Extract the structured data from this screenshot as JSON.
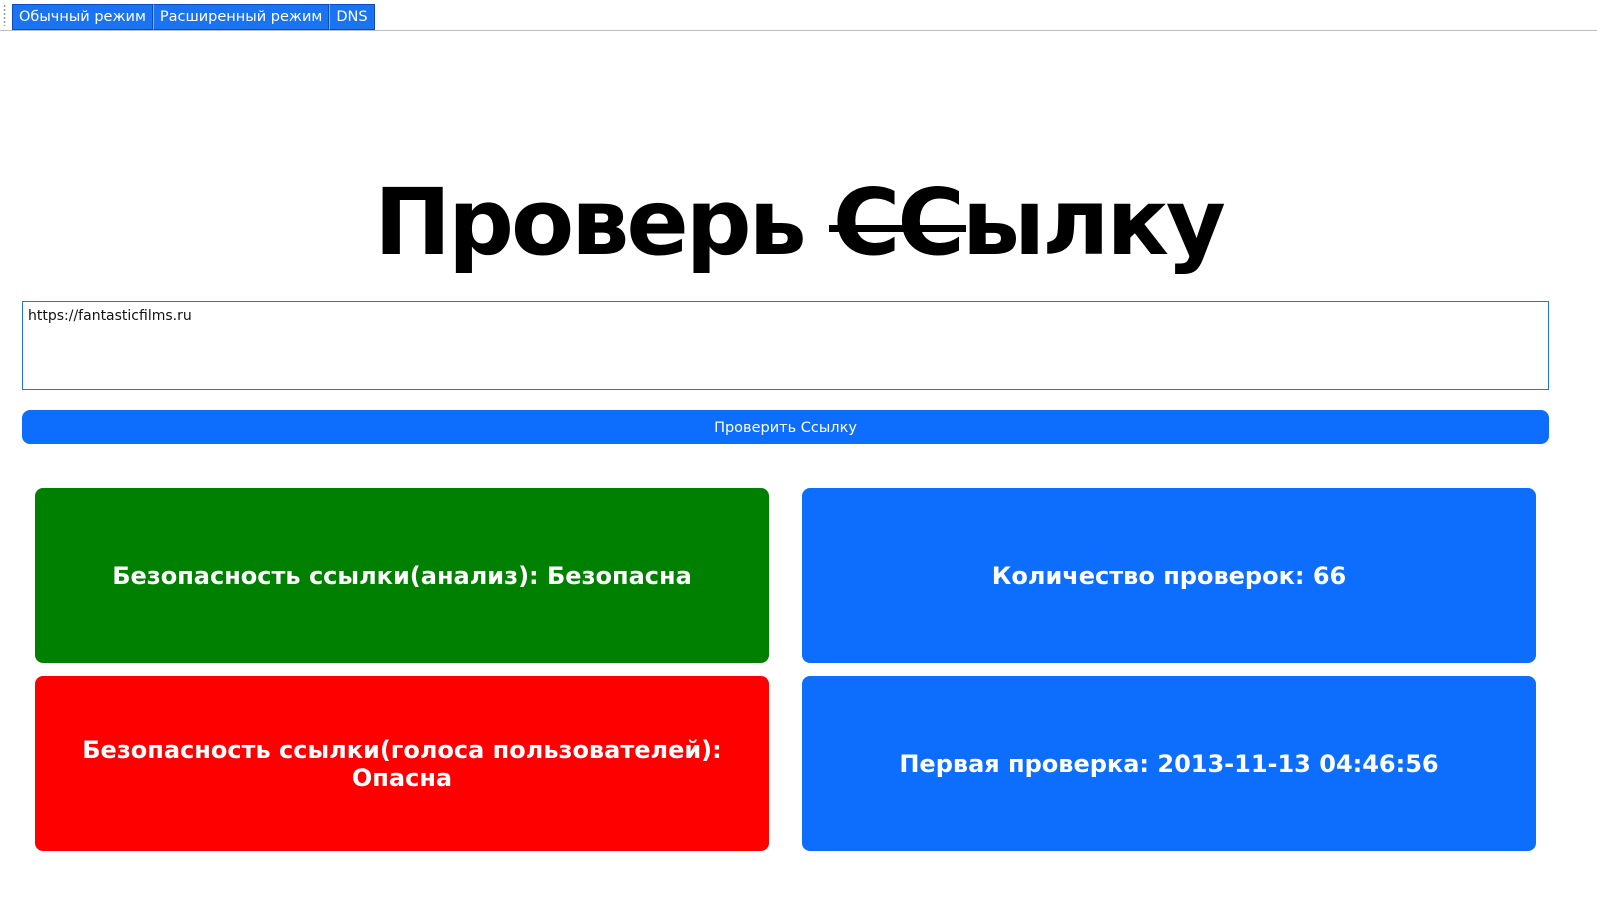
{
  "tabs": [
    {
      "label": "Обычный режим"
    },
    {
      "label": "Расширенный режим"
    },
    {
      "label": "DNS"
    }
  ],
  "header": {
    "title_part1": "Проверь ",
    "title_strike": "СС",
    "title_part2": "ылку"
  },
  "form": {
    "url_value": "https://fantasticfilms.ru",
    "check_button_label": "Проверить Ссылку"
  },
  "results": [
    {
      "text": "Безопасность ссылки(анализ): Безопасна",
      "color": "#008000"
    },
    {
      "text": "Количество проверок: 66",
      "color": "#0d6efd"
    },
    {
      "text": "Безопасность ссылки(голоса пользователей): Опасна",
      "color": "#ff0000"
    },
    {
      "text": "Первая проверка: 2013-11-13 04:46:56",
      "color": "#0d6efd"
    }
  ]
}
